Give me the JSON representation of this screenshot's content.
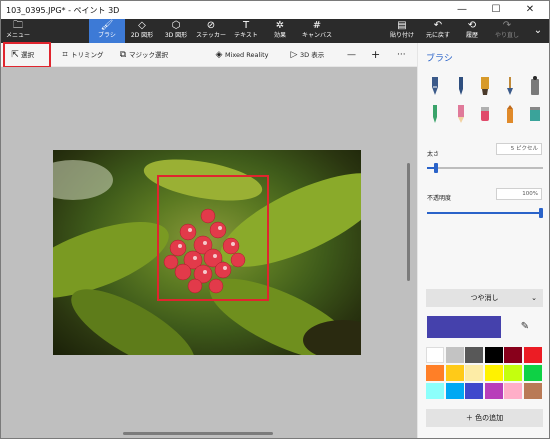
{
  "window": {
    "title": "103_0395.JPG* - ペイント 3D"
  },
  "ribbon": {
    "menu": "メニュー",
    "brush": "ブラシ",
    "shapes2d": "2D 図形",
    "shapes3d": "3D 図形",
    "stickers": "ステッカー",
    "text": "テキスト",
    "effects": "効果",
    "canvas": "キャンバス",
    "paste": "貼り付け",
    "undo": "元に戻す",
    "history": "履歴",
    "redo": "やり直し"
  },
  "toolbar": {
    "select": "選択",
    "crop": "トリミング",
    "magic": "マジック選択",
    "mixed": "Mixed Reality",
    "view3d": "3D 表示",
    "zoom_out": "—",
    "zoom_in": "+",
    "more": "···"
  },
  "panel": {
    "title": "ブラシ",
    "thickness_label": "太さ",
    "thickness_value": "5 ピクセル",
    "thickness_level": 0.06,
    "opacity_label": "不透明度",
    "opacity_value": "100%",
    "opacity_level": 1.0,
    "finish": "つや消し",
    "add_color": "色の追加",
    "current_color": "#4541ac",
    "palette": [
      "#ffffff",
      "#c3c3c3",
      "#585858",
      "#000000",
      "#88001b",
      "#ec1c24",
      "#ff7f27",
      "#ffca18",
      "#fdeca6",
      "#fff200",
      "#c4ff0e",
      "#0ed145",
      "#8cfffb",
      "#00a8f3",
      "#3f48cc",
      "#b83dba",
      "#ffaec8",
      "#b97a56"
    ]
  },
  "icons": {
    "brushes": [
      "calligraphy-pen-icon",
      "ink-pen-icon",
      "oil-brush-icon",
      "watercolor-icon",
      "pixel-pen-icon",
      "pencil-icon",
      "eraser-icon",
      "crayon-icon",
      "spray-can-icon",
      "fill-bucket-icon"
    ]
  }
}
